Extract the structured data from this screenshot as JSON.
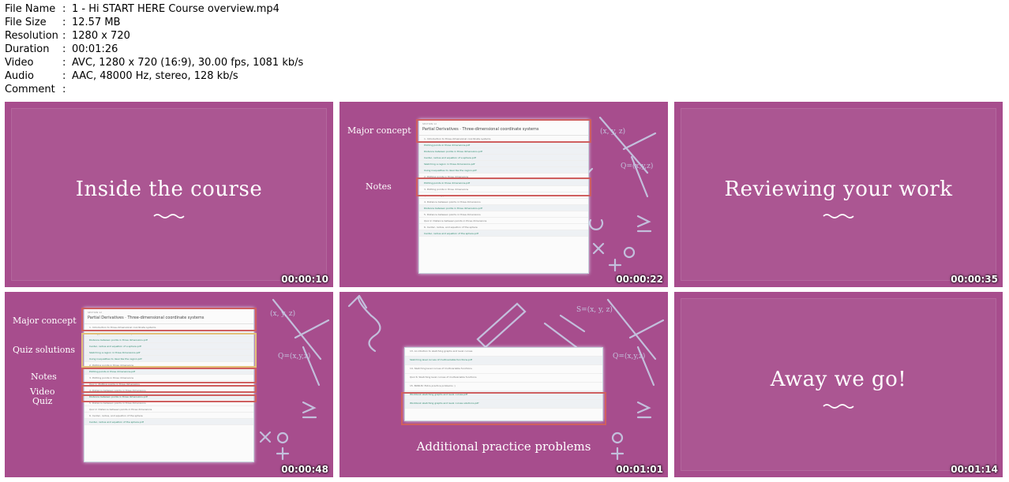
{
  "info": {
    "rows": [
      {
        "key": "File Name",
        "value": "1 - Hi START HERE Course overview.mp4"
      },
      {
        "key": "File Size",
        "value": "12.57 MB"
      },
      {
        "key": "Resolution",
        "value": "1280 x 720"
      },
      {
        "key": "Duration",
        "value": "00:01:26"
      },
      {
        "key": "Video",
        "value": "AVC, 1280 x 720 (16:9), 30.00 fps, 1081 kb/s"
      },
      {
        "key": "Audio",
        "value": "AAC, 48000 Hz, stereo, 128 kb/s"
      },
      {
        "key": "Comment",
        "value": ""
      }
    ],
    "separator": ":"
  },
  "colors": {
    "slide_bg": "#a74d8d",
    "highlight_red": "#cf5f5f",
    "highlight_yellow": "#e3c07a"
  },
  "thumbs": [
    {
      "timestamp": "00:00:10",
      "title": "Inside the course"
    },
    {
      "timestamp": "00:00:22",
      "labels": [
        "Major concept",
        "Notes"
      ]
    },
    {
      "timestamp": "00:00:35",
      "title": "Reviewing your work"
    },
    {
      "timestamp": "00:00:48",
      "labels": [
        "Major concept",
        "Quiz solutions",
        "Notes",
        "Video",
        "Quiz"
      ]
    },
    {
      "timestamp": "00:01:01",
      "caption": "Additional practice problems"
    },
    {
      "timestamp": "00:01:14",
      "title": "Away we go!"
    }
  ]
}
